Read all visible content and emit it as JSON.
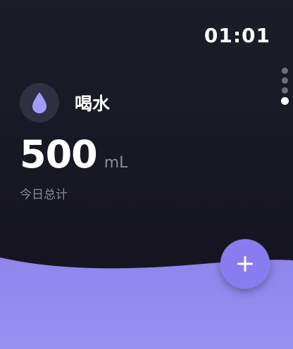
{
  "status_bar": {
    "time": "01:01"
  },
  "app": {
    "title": "喝水",
    "icon": "water-drop-icon"
  },
  "summary": {
    "value": "500",
    "unit": "mL",
    "caption": "今日总计"
  },
  "page_indicator": {
    "count": 4,
    "active_index": 3
  },
  "actions": {
    "add_icon": "plus-icon"
  },
  "colors": {
    "background": "#17161f",
    "accent": "#8a7cf0",
    "wave": "#8d84ea",
    "icon_circle": "#2f3042",
    "drop": "#a49af7",
    "secondary_text": "#8c8c96"
  }
}
